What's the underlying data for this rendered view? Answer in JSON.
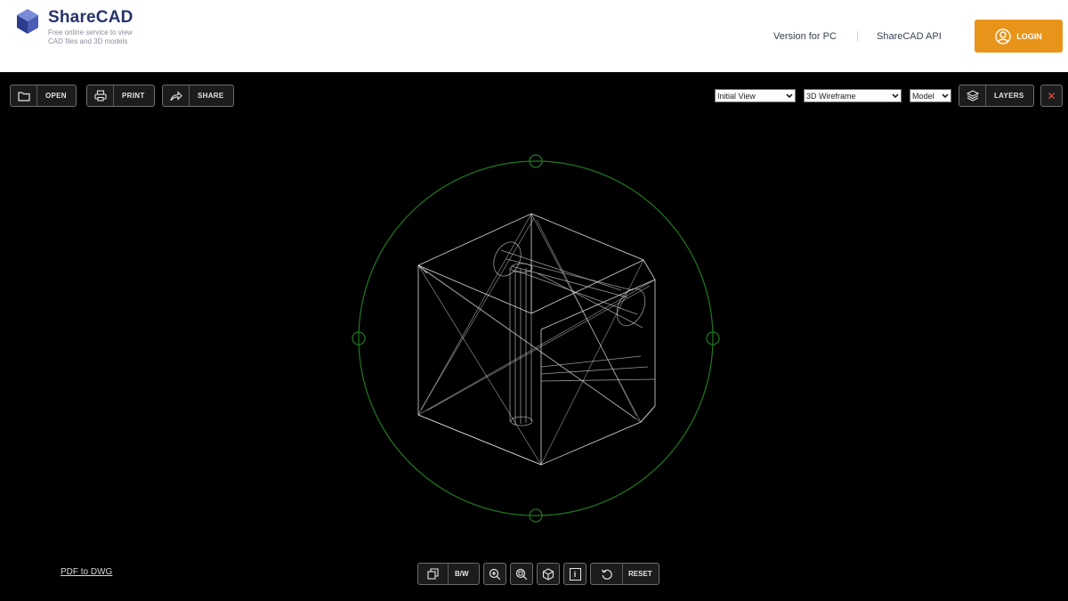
{
  "header": {
    "brand_name": "ShareCAD",
    "tagline": "Free online service to view CAD files and 3D models",
    "nav": {
      "version_pc": "Version for PC",
      "api": "ShareCAD API"
    },
    "login_label": "LOGIN"
  },
  "toolbar": {
    "open_label": "OPEN",
    "print_label": "PRINT",
    "share_label": "SHARE",
    "view_select": "Initial View",
    "mode_select": "3D Wireframe",
    "space_select": "Model",
    "layers_label": "LAYERS",
    "close_symbol": "✕"
  },
  "bottom_bar": {
    "bw_label": "B/W",
    "reset_label": "RESET",
    "pdf_link": "PDF to DWG",
    "info_symbol": "i"
  },
  "colors": {
    "accent": "#e8941a",
    "brand": "#26336b",
    "orbit": "#1f7a1f",
    "wire": "#d9d9d9",
    "close": "#e34d4d"
  },
  "icons": [
    "logo-cube-icon",
    "folder-icon",
    "printer-icon",
    "share-arrow-icon",
    "layers-icon",
    "close-icon",
    "user-circle-icon",
    "window-copy-icon",
    "zoom-in-icon",
    "zoom-fit-icon",
    "cube-icon",
    "info-icon",
    "reset-icon"
  ]
}
